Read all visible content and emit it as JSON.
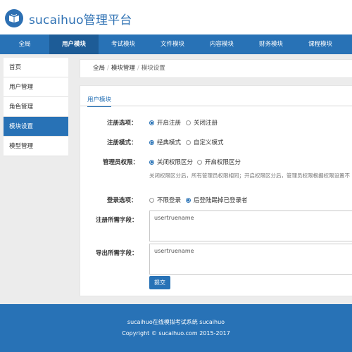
{
  "brand": {
    "name": "sucaihuo管理平台",
    "logo_icon": "book-icon",
    "color": "#2d70b3"
  },
  "nav": {
    "items": [
      {
        "label": "全局"
      },
      {
        "label": "用户模块",
        "active": true
      },
      {
        "label": "考试模块"
      },
      {
        "label": "文件模块"
      },
      {
        "label": "内容模块"
      },
      {
        "label": "财务模块"
      },
      {
        "label": "课程模块"
      }
    ],
    "background": "#2872b6"
  },
  "sidebar": {
    "items": [
      {
        "label": "首页"
      },
      {
        "label": "用户管理"
      },
      {
        "label": "角色管理"
      },
      {
        "label": "模块设置",
        "active": true
      },
      {
        "label": "模型管理"
      }
    ]
  },
  "breadcrumb": {
    "root": "全局",
    "module": "模块管理",
    "current": "模块设置"
  },
  "panel": {
    "tab": "用户模块",
    "register_option": {
      "label": "注册选项：",
      "options": [
        "开启注册",
        "关闭注册"
      ],
      "selected": "开启注册"
    },
    "register_mode": {
      "label": "注册模式：",
      "options": [
        "经典模式",
        "自定义模式"
      ],
      "selected": "经典模式"
    },
    "admin_permission": {
      "label": "管理员权限：",
      "options": [
        "关闭权限区分",
        "开启权限区分"
      ],
      "selected": "关闭权限区分",
      "hint": "关闭权限区分后，所有管理员权限相同；开启权限区分后，管理员权限根据权限设置不"
    },
    "login_option": {
      "label": "登录选项：",
      "options": [
        "不限登录",
        "后登陆踢掉已登录者"
      ],
      "selected": "后登陆踢掉已登录者"
    },
    "register_fields": {
      "label": "注册所需字段：",
      "value": "usertruename"
    },
    "export_fields": {
      "label": "导出所需字段：",
      "value": "usertruename"
    },
    "submit_label": "提交"
  },
  "footer": {
    "line1": "sucaihuo在线模拟考试系统 sucaihuo",
    "line2": "Copyright © sucaihuo.com 2015-2017"
  }
}
